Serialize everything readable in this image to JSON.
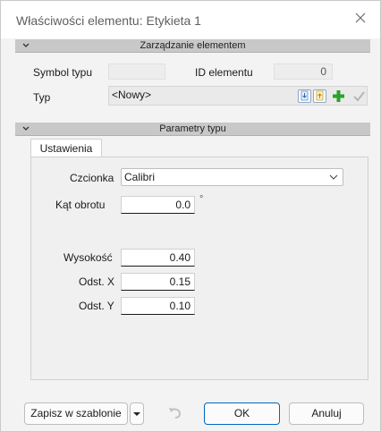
{
  "window": {
    "title": "Właściwości elementu: Etykieta 1"
  },
  "management": {
    "header": "Zarządzanie elementem",
    "symbol_label": "Symbol typu",
    "symbol_value": "",
    "id_label": "ID elementu",
    "id_value": "0",
    "type_label": "Typ",
    "type_value": "<Nowy>"
  },
  "params": {
    "header": "Parametry typu",
    "tab_label": "Ustawienia",
    "font_label": "Czcionka",
    "font_value": "Calibri",
    "rotation_label": "Kąt obrotu",
    "rotation_value": "0.0",
    "rotation_unit": "°",
    "height_label": "Wysokość",
    "height_value": "0.40",
    "offx_label": "Odst. X",
    "offx_value": "0.15",
    "offy_label": "Odst. Y",
    "offy_value": "0.10"
  },
  "footer": {
    "save_template_label": "Zapisz w szablonie",
    "ok_label": "OK",
    "cancel_label": "Anuluj"
  },
  "icons": [
    "close-icon",
    "chevron-up-icon",
    "download-icon",
    "upload-icon",
    "add-icon",
    "checkmark-icon",
    "dropdown-arrow-icon",
    "undo-icon"
  ],
  "colors": {
    "ok_border": "#0067c0",
    "add_green": "#2ca02c",
    "section_bar": "#c8c8c8"
  }
}
